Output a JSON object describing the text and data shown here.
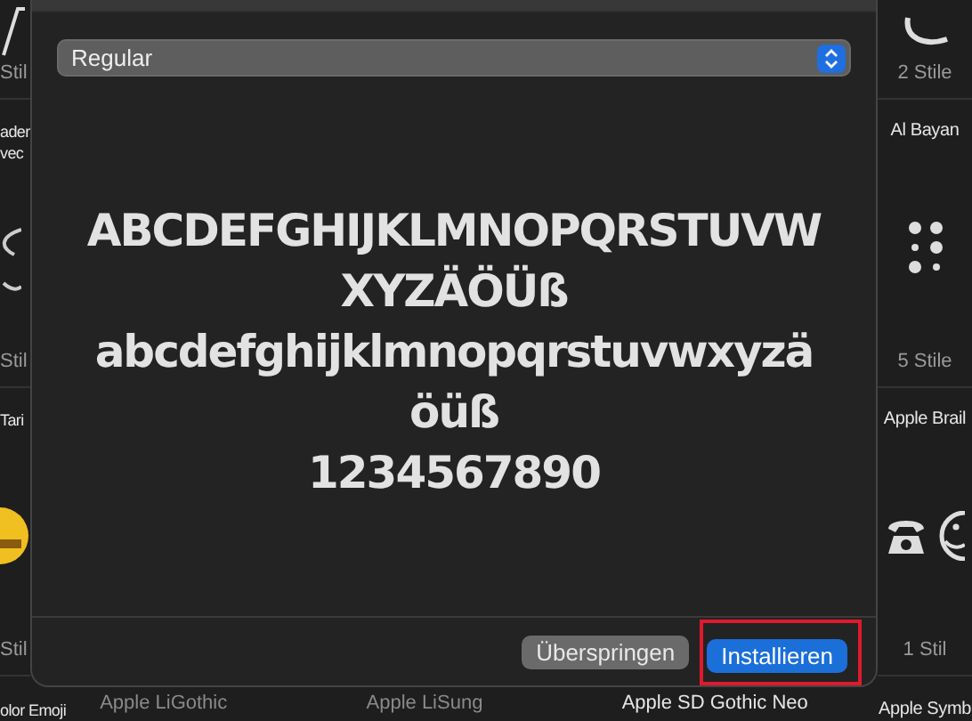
{
  "background": {
    "left_column": [
      {
        "style_count": "Stil",
        "kind": "swash"
      },
      {
        "name": "ader\nvec",
        "style_count": "Stil",
        "kind": "curl"
      },
      {
        "name": "Tari",
        "style_count": "Stil",
        "kind": "emoji"
      },
      {
        "name": "olor Emoji"
      }
    ],
    "right_column": [
      {
        "style_count": "2 Stile",
        "kind": "crescent"
      },
      {
        "name": "Al Bayan",
        "style_count": "5 Stile",
        "kind": "braille"
      },
      {
        "name": "Apple Brail",
        "style_count": "1 Stil",
        "kind": "symbols"
      },
      {
        "name": "Apple Symb"
      }
    ],
    "bottom_labels": [
      {
        "name": "Apple LiGothic",
        "dimmed": true
      },
      {
        "name": "Apple LiSung",
        "dimmed": true
      },
      {
        "name": "Apple SD Gothic Neo",
        "dimmed": false
      }
    ]
  },
  "dialog": {
    "style_select": {
      "value": "Regular"
    },
    "preview_lines": [
      "ABCDEFGHIJKLMNOPQRSTUVW",
      "XYZÄÖÜß",
      "abcdefghijklmnopqrstuvwxyzä",
      "öüß",
      "1234567890"
    ],
    "buttons": [
      {
        "label": "Überspringen",
        "kind": "secondary",
        "highlighted": false
      },
      {
        "label": "Installieren",
        "kind": "primary",
        "highlighted": true
      }
    ]
  }
}
